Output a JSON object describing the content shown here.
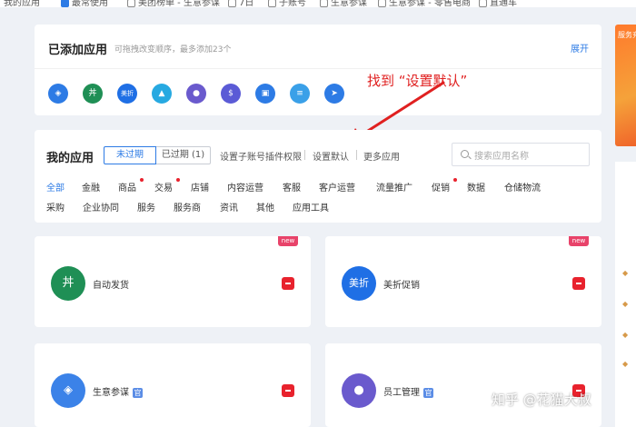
{
  "bookmarks": [
    "我的应用",
    "最常使用",
    "美团榜单 - 生意参谋",
    "7日",
    "子账号",
    "生意参谋",
    "生意参谋 - 零售电商",
    "直通车"
  ],
  "added_apps": {
    "title": "已添加应用",
    "subtitle": "可拖拽改变顺序，最多添加23个",
    "expand_label": "展开",
    "icons": [
      {
        "name": "compass-icon",
        "glyph": "◈",
        "color": "#2d7be5"
      },
      {
        "name": "auto-ship-icon",
        "glyph": "丼",
        "color": "#1f8f55"
      },
      {
        "name": "meizhe-icon",
        "glyph": "美折",
        "color": "#1f6fe5"
      },
      {
        "name": "shoe-icon",
        "glyph": "▲",
        "color": "#27a9e1"
      },
      {
        "name": "staff-icon",
        "glyph": "●",
        "color": "#6a5acd"
      },
      {
        "name": "money-bag-icon",
        "glyph": "$",
        "color": "#5b5bd6"
      },
      {
        "name": "shop-bag-icon",
        "glyph": "▣",
        "color": "#2d7be5"
      },
      {
        "name": "coupon-icon",
        "glyph": "≡",
        "color": "#3aa0e8"
      },
      {
        "name": "send-icon",
        "glyph": "➤",
        "color": "#2d7be5"
      }
    ]
  },
  "annotation": {
    "text": "找到 “设置默认”",
    "color": "#e02020"
  },
  "my_apps": {
    "title": "我的应用",
    "tab_active": "未过期",
    "tab_inactive": "已过期 (1)",
    "link_permissions": "设置子账号插件权限",
    "link_default": "设置默认",
    "link_more": "更多应用",
    "search_placeholder": "搜索应用名称",
    "categories_row1": [
      "全部",
      "金融",
      "商品",
      "交易",
      "店铺",
      "内容运营",
      "客服",
      "客户运营",
      "流量推广",
      "促销",
      "数据",
      "仓储物流"
    ],
    "categories_row2": [
      "采购",
      "企业协同",
      "服务",
      "服务商",
      "资讯",
      "其他",
      "应用工具"
    ]
  },
  "cards": [
    {
      "name": "自动发货",
      "glyph": "丼",
      "color": "#1f8f55",
      "new_tag": "new",
      "official": false
    },
    {
      "name": "美折促销",
      "glyph": "美折",
      "color": "#1f6fe5",
      "new_tag": "new",
      "official": false
    },
    {
      "name": "生意参谋",
      "glyph": "◈",
      "color": "#3b82e8",
      "new_tag": "",
      "official": true
    },
    {
      "name": "员工管理",
      "glyph": "●",
      "color": "#6a5acd",
      "new_tag": "",
      "official": true
    }
  ],
  "official_badge": "官",
  "banner_text": "服务充",
  "watermark": "知乎 @花猫大叔"
}
